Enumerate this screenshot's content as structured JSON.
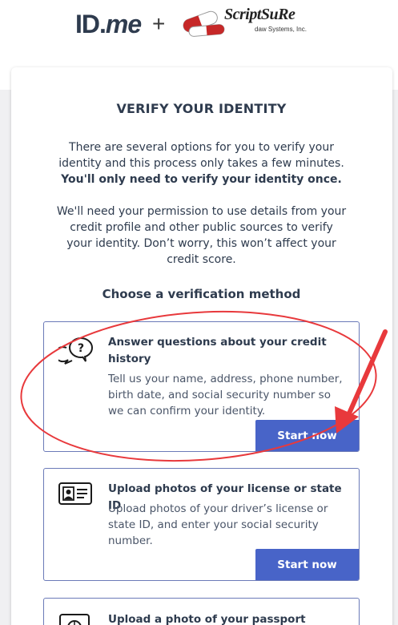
{
  "header": {
    "idme_logo": {
      "id": "ID",
      "dot": ".",
      "me": "me"
    },
    "plus": "+",
    "partner_logo": {
      "name": "ScriptSuRe",
      "sub": "daw Systems, Inc."
    }
  },
  "page": {
    "title": "VERIFY YOUR IDENTITY",
    "intro": "There are several options for you to verify your identity and this process only takes a few minutes.",
    "intro_bold": "You'll only need to verify your identity once.",
    "intro2": "We'll need your permission to use details from your credit profile and other public sources to verify your identity. Don’t worry, this won’t affect your credit score.",
    "choose_heading": "Choose a verification method"
  },
  "options": [
    {
      "icon": "question-chat-icon",
      "title": "Answer questions about your credit history",
      "description": "Tell us your name, address, phone number, birth date, and social security number so we can confirm your identity.",
      "button": "Start now"
    },
    {
      "icon": "id-card-icon",
      "title": "Upload photos of your license or state ID",
      "description": "Upload photos of your driver’s license or state ID, and enter your social security number.",
      "button": "Start now"
    },
    {
      "icon": "passport-icon",
      "title": "Upload a photo of your passport",
      "description": "",
      "button": ""
    }
  ],
  "colors": {
    "button": "#4864c8",
    "text": "#2e3b4e",
    "annotation": "#e8393c"
  }
}
